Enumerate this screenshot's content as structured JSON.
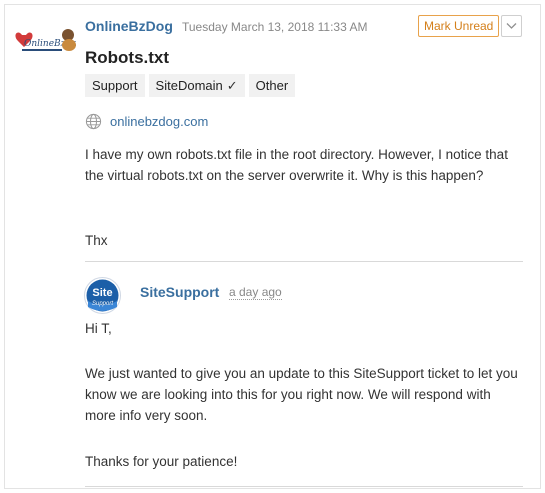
{
  "header": {
    "author": "OnlineBzDog",
    "timestamp": "Tuesday March 13, 2018 11:33 AM",
    "mark_unread_label": "Mark Unread",
    "avatar_text": "OnlineBzDog"
  },
  "ticket": {
    "subject": "Robots.txt",
    "tags": [
      {
        "label": "Support"
      },
      {
        "label": "SiteDomain",
        "check": "✓"
      },
      {
        "label": "Other"
      }
    ],
    "website": "onlinebzdog.com",
    "body": [
      "I have my own robots.txt file in the root directory. However, I notice that the virtual robots.txt on the server overwrite it. Why is this happen?",
      "Thx"
    ]
  },
  "reply": {
    "author": "SiteSupport",
    "time": "a day ago",
    "avatar_text": "Site",
    "avatar_subtext": "Support",
    "body": [
      "Hi T,",
      "We just wanted to give you an update to this SiteSupport ticket to let you know we are looking into this for you right now. We will respond with more info very soon.",
      "Thanks for your patience!"
    ]
  },
  "colors": {
    "link": "#3a6f9f",
    "accent_orange": "#d47f1a",
    "support_blue": "#1c5fa8"
  }
}
